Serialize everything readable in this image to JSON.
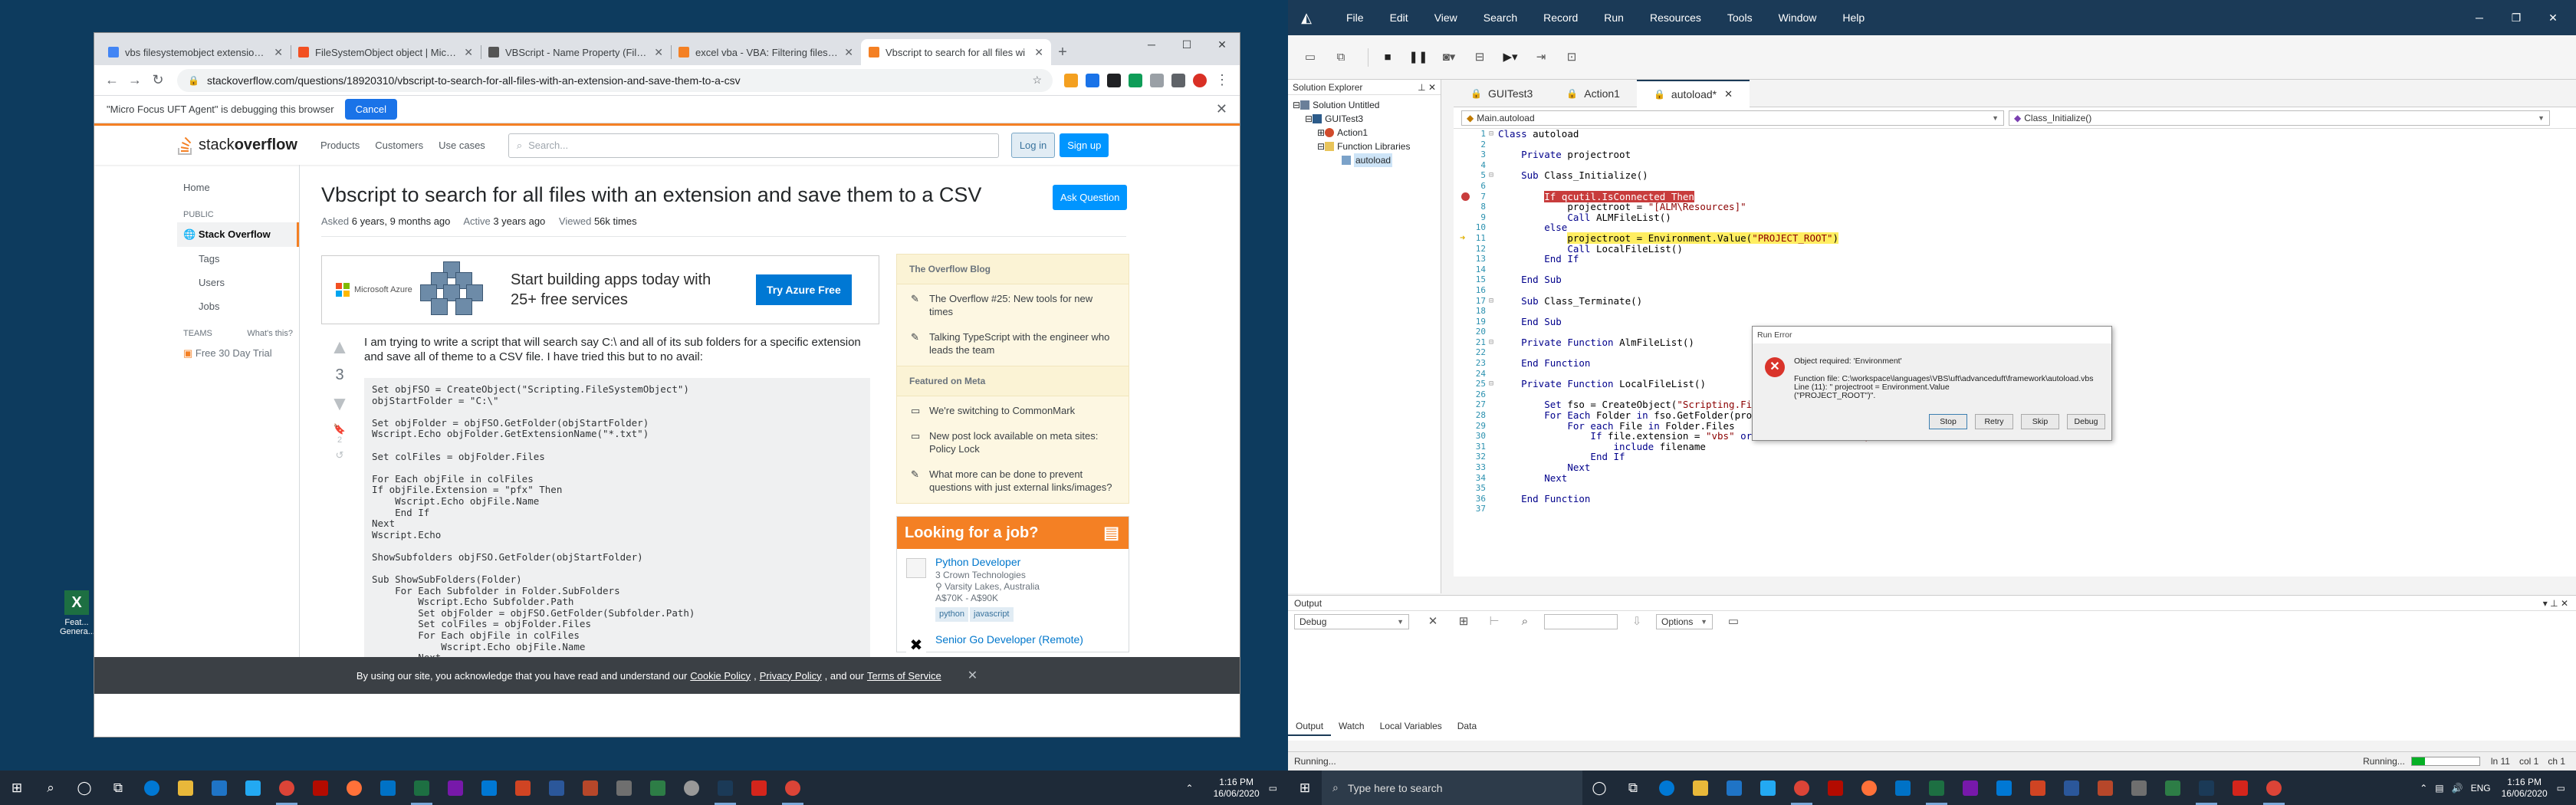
{
  "desktop": {
    "icon_label": "Feat... Genera..."
  },
  "chrome": {
    "tabs": [
      {
        "title": "vbs filesystemobject extension fo",
        "color": "#4285f4",
        "active": false
      },
      {
        "title": "FileSystemObject object | Micros",
        "color": "#f25022",
        "active": false
      },
      {
        "title": "VBScript - Name Property (FileSy",
        "color": "#555555",
        "active": false
      },
      {
        "title": "excel vba - VBA: Filtering files fro",
        "color": "#f48024",
        "active": false
      },
      {
        "title": "Vbscript to search for all files wi",
        "color": "#f48024",
        "active": true
      }
    ],
    "url": "stackoverflow.com/questions/18920310/vbscript-to-search-for-all-files-with-an-extension-and-save-them-to-a-csv",
    "debug_message": "\"Micro Focus UFT Agent\" is debugging this browser",
    "debug_cancel": "Cancel"
  },
  "so": {
    "logo_a": "stack",
    "logo_b": "overflow",
    "nav": [
      "Products",
      "Customers",
      "Use cases"
    ],
    "search_placeholder": "Search...",
    "login": "Log in",
    "signup": "Sign up",
    "leftnav": {
      "home": "Home",
      "public": "PUBLIC",
      "stackoverflow": "Stack Overflow",
      "tags": "Tags",
      "users": "Users",
      "jobs": "Jobs",
      "teams": "TEAMS",
      "whats_this": "What's this?",
      "free_trial": "Free 30 Day Trial"
    },
    "question": {
      "title": "Vbscript to search for all files with an extension and save them to a CSV",
      "ask_button": "Ask Question",
      "asked_label": "Asked",
      "asked": "6 years, 9 months ago",
      "active_label": "Active",
      "active": "3 years ago",
      "viewed_label": "Viewed",
      "viewed": "56k times",
      "votes": "3",
      "bookmarks": "2",
      "body": "I am trying to write a script that will search say C:\\ and all of its sub folders for a specific extension and save all of theme to a CSV file. I have tried this but to no avail:",
      "code": "Set objFSO = CreateObject(\"Scripting.FileSystemObject\")\nobjStartFolder = \"C:\\\"\n\nSet objFolder = objFSO.GetFolder(objStartFolder)\nWscript.Echo objFolder.GetExtensionName(\"*.txt\")\n\nSet colFiles = objFolder.Files\n\nFor Each objFile in colFiles\nIf objFile.Extension = \"pfx\" Then\n    Wscript.Echo objFile.Name\n    End If\nNext\nWscript.Echo\n\nShowSubfolders objFSO.GetFolder(objStartFolder)\n\nSub ShowSubFolders(Folder)\n    For Each Subfolder in Folder.SubFolders\n        Wscript.Echo Subfolder.Path\n        Set objFolder = objFSO.GetFolder(Subfolder.Path)\n        Set colFiles = objFolder.Files\n        For Each objFile in colFiles\n            Wscript.Echo objFile.Name\n        Next"
    },
    "ad": {
      "brand": "Microsoft Azure",
      "text": "Start building apps today with 25+ free services",
      "button": "Try Azure Free"
    },
    "blog": {
      "header": "The Overflow Blog",
      "items": [
        "The Overflow #25: New tools for new times",
        "Talking TypeScript with the engineer who leads the team"
      ],
      "meta_header": "Featured on Meta",
      "meta_items": [
        "We're switching to CommonMark",
        "New post lock available on meta sites: Policy Lock",
        "What more can be done to prevent questions with just external links/images?"
      ]
    },
    "jobs": {
      "header": "Looking for a job?",
      "items": [
        {
          "title": "Python Developer",
          "company": "3 Crown Technologies",
          "location": "Varsity Lakes, Australia",
          "salary": "A$70K - A$90K",
          "tags": [
            "python",
            "javascript"
          ]
        },
        {
          "title": "Senior Go Developer (Remote)"
        }
      ]
    },
    "cookie": {
      "pre": "By using our site, you acknowledge that you have read and understand our",
      "cookie_policy": "Cookie Policy",
      "privacy": "Privacy Policy",
      "and": ", and our",
      "terms": "Terms of Service"
    }
  },
  "uft": {
    "menu": [
      "File",
      "Edit",
      "View",
      "Search",
      "Record",
      "Run",
      "Resources",
      "Tools",
      "Window",
      "Help"
    ],
    "solution_explorer": {
      "title": "Solution Explorer",
      "nodes": [
        "Solution Untitled",
        "GUITest3",
        "Action1",
        "Function Libraries",
        "autoload"
      ]
    },
    "editor_tabs": [
      "GUITest3",
      "Action1",
      "autoload*"
    ],
    "combo_left": "Main.autoload",
    "combo_right": "Class_Initialize()",
    "code_lines": [
      "Class autoload",
      "",
      "    Private projectroot",
      "",
      "    Sub Class_Initialize()",
      "",
      "        If qcutil.IsConnected Then",
      "            projectroot = \"[ALM\\Resources]\"",
      "            Call ALMFileList()",
      "        else",
      "            projectroot = Environment.Value(\"PROJECT_ROOT\")",
      "            Call LocalFileList()",
      "        End If",
      "",
      "    End Sub",
      "",
      "    Sub Class_Terminate()",
      "",
      "    End Sub",
      "",
      "    Private Function AlmFileList()",
      "",
      "    End Function",
      "",
      "    Private Function LocalFileList()",
      "",
      "        Set fso = CreateObject(\"Scripting.FileSystemObject\")",
      "        For Each Folder in fso.GetFolder(projectroot).SubFolders",
      "            For each File in Folder.Files",
      "                If file.extension = \"vbs\" or file.extension = \"qfl\" Then",
      "                    include filename",
      "                End If",
      "            Next",
      "        Next",
      "",
      "    End Function",
      ""
    ],
    "run_error": {
      "title": "Run Error",
      "line1": "Object required: 'Environment'",
      "line2": "Function file: C:\\workspace\\languages\\VBS\\uft\\advanceduft\\framework\\autoload.vbs",
      "line3": "Line (11): \"            projectroot = Environment.Value",
      "line4": "(\"PROJECT_ROOT\")\".",
      "buttons": [
        "Stop",
        "Retry",
        "Skip",
        "Debug"
      ]
    },
    "output": {
      "title": "Output",
      "filter": "Debug",
      "options": "Options",
      "tabs": [
        "Output",
        "Watch",
        "Local Variables",
        "Data"
      ]
    },
    "status": {
      "left": "Running...",
      "right": "Running...",
      "progress": 0.2,
      "ln": "ln 11",
      "col": "col 1",
      "ch": "ch 1"
    }
  },
  "taskbar": {
    "search_placeholder": "Type here to search",
    "lang": "ENG",
    "time": "1:16 PM",
    "date": "16/06/2020"
  }
}
